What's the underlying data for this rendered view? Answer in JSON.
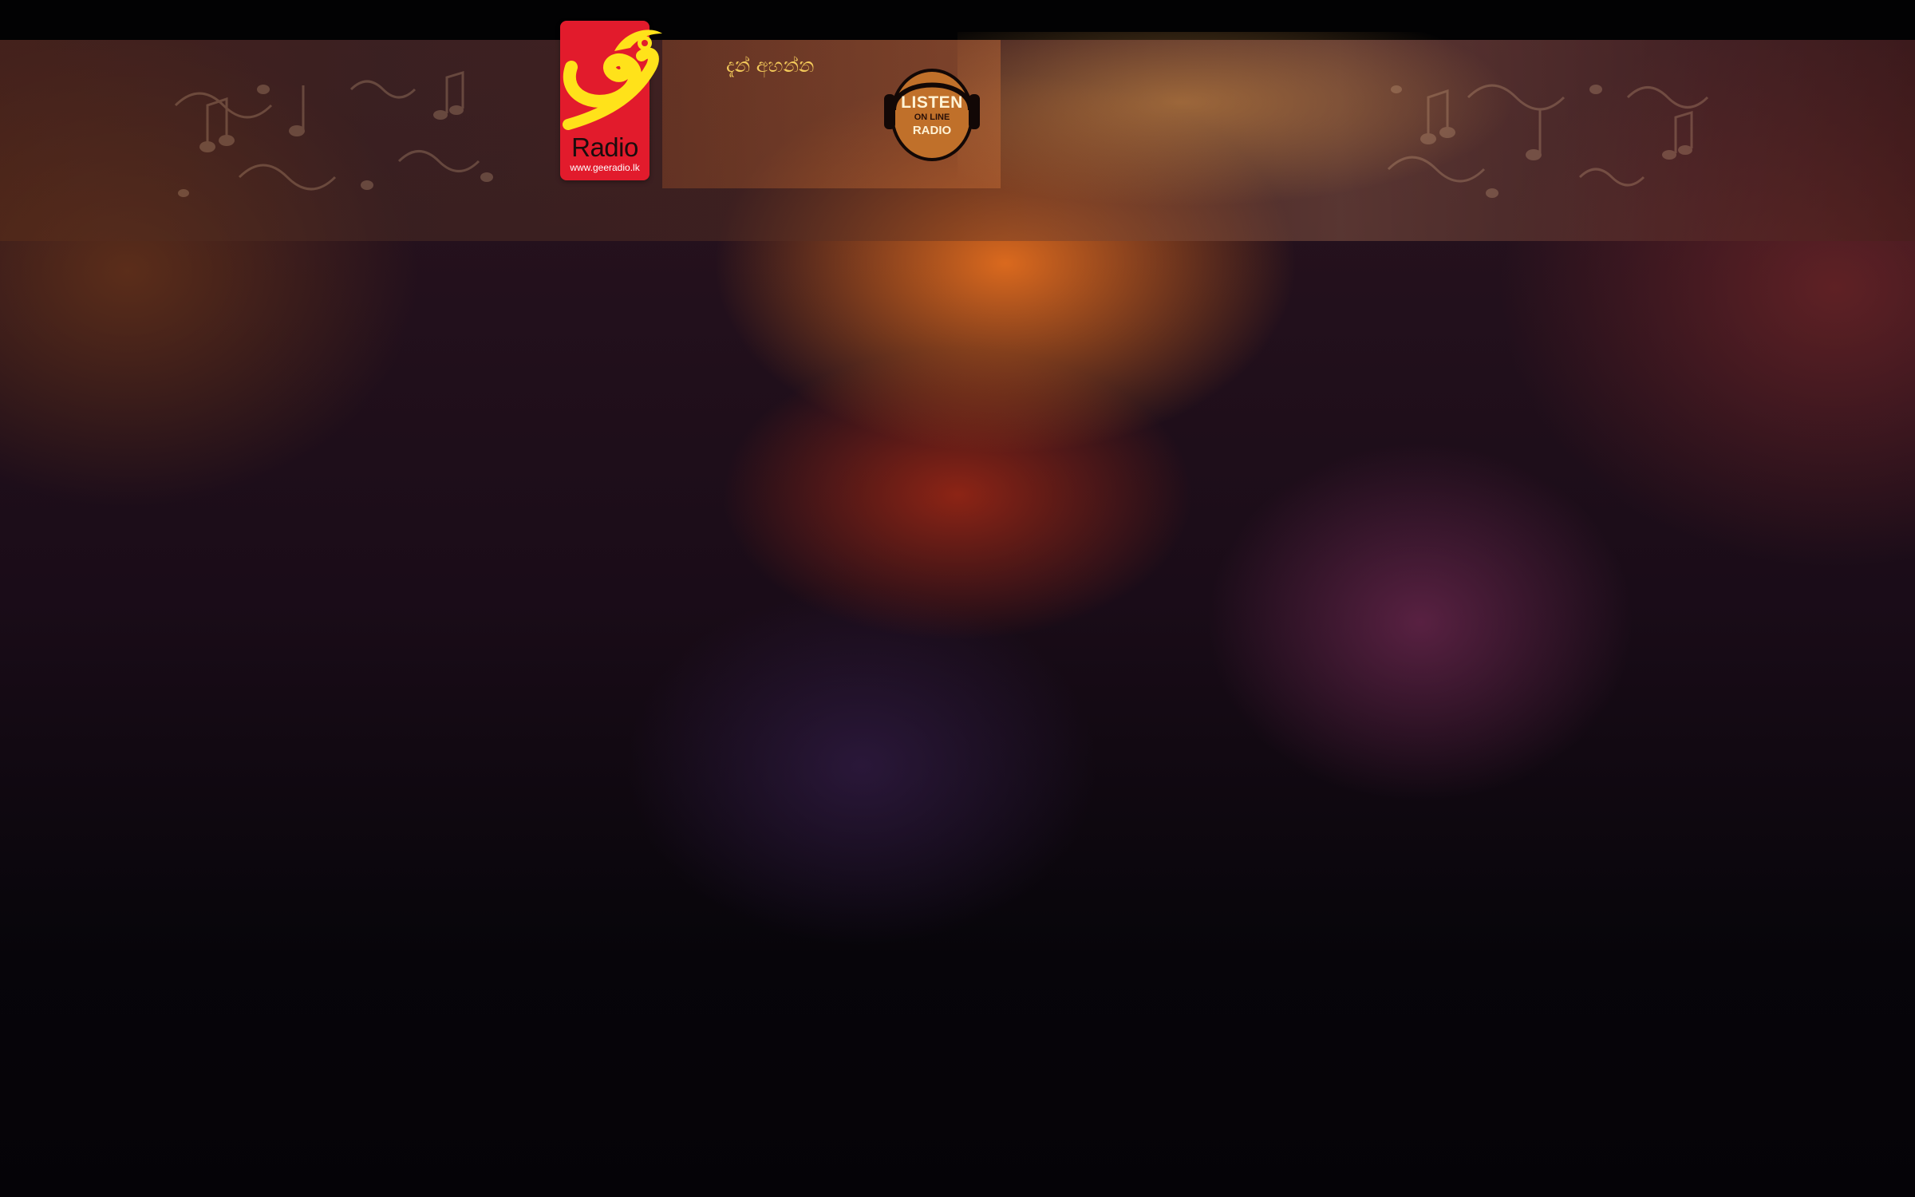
{
  "topbar": {},
  "logo": {
    "word": "Radio",
    "url": "www.geeradio.lk",
    "colors": {
      "card": "#e21b2c",
      "glyph": "#ffe21a"
    }
  },
  "nav": {
    "listen_now_label": "දැන් අහන්න"
  },
  "listen_badge": {
    "word": "LISTEN",
    "subline": "ON LINE",
    "radio": "RADIO",
    "icon": "headphones-icon"
  },
  "decor": {
    "pattern_icon": "music-notes-pattern",
    "accent": "#f3c95a"
  }
}
